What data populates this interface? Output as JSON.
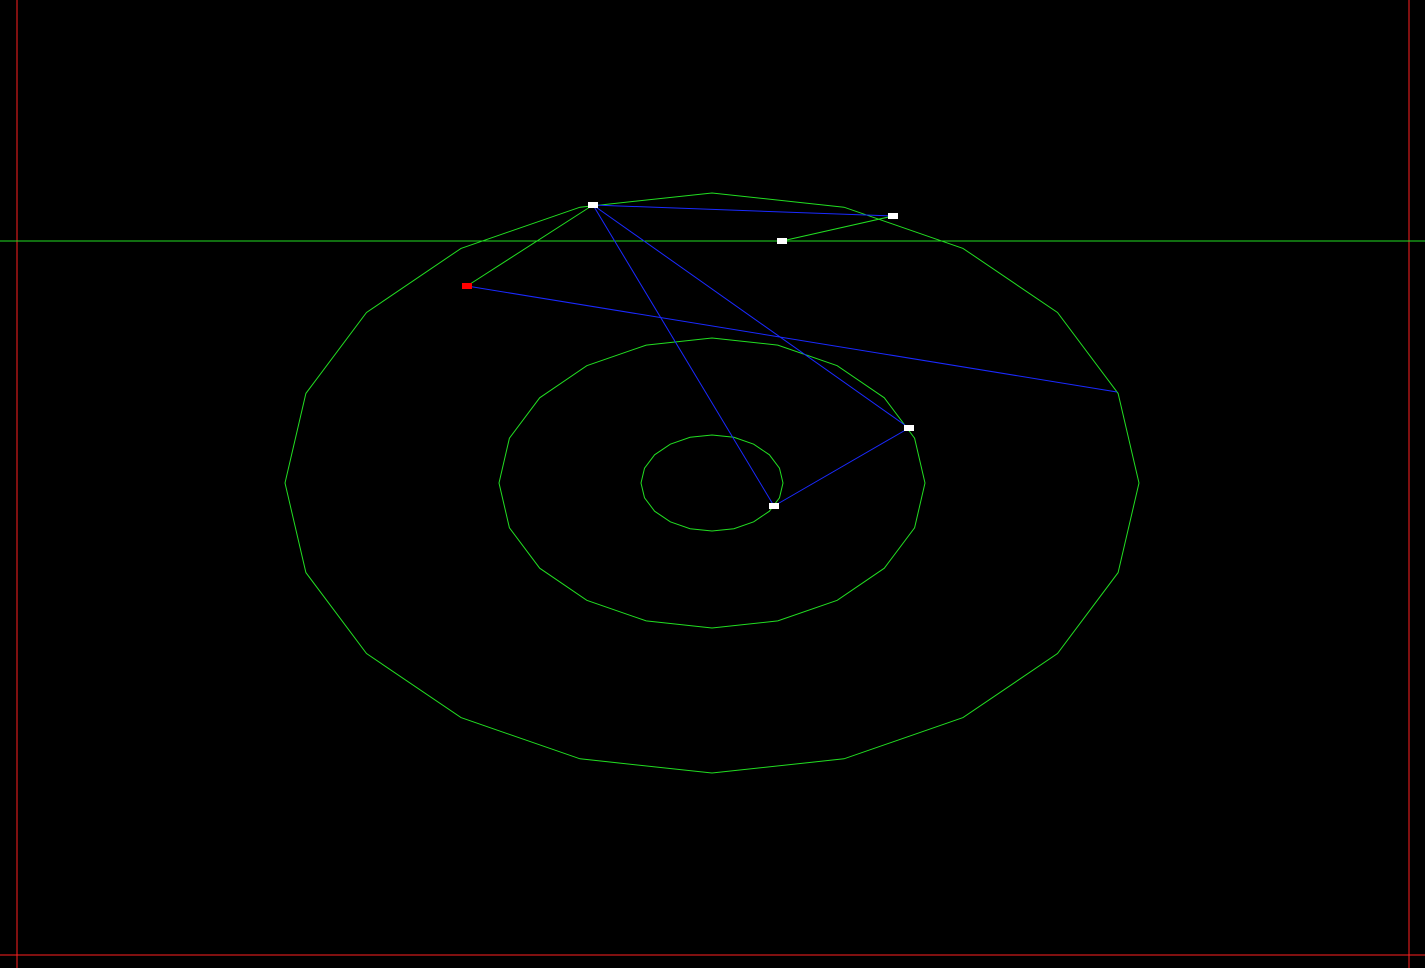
{
  "scene": {
    "background_color": "#000000",
    "colors": {
      "boundary": "#ff2020",
      "ring": "#22dd22",
      "horizon": "#22dd22",
      "link": "#1a2aff",
      "node": "#ffffff",
      "selected_node": "#ff0000"
    },
    "rings_count": 3,
    "nodes_count": 6,
    "selected_node_index": 0
  }
}
